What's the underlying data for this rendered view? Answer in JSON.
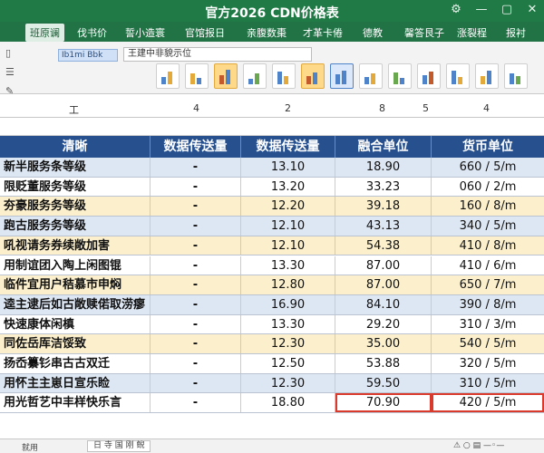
{
  "window": {
    "title": "官方2026 CDN价格表",
    "controls": [
      "⚙",
      "—",
      "▢",
      "✕"
    ]
  },
  "menubar": {
    "items": [
      "班原谰",
      "伐书价",
      "誓小造寰",
      "官馆报日",
      "亲腹数棗",
      "才革卡倦",
      "德教",
      "馨答艮子",
      "涨裂程",
      "报衬"
    ]
  },
  "toolbar": {
    "name_box": "Ib1mi Bbk",
    "formula": "王建中非貌示位"
  },
  "column_header": {
    "labels": [
      "工",
      "4",
      "2",
      "8",
      "5",
      "4"
    ]
  },
  "table": {
    "headers": [
      "清晰",
      "数据传送量",
      "数据传送量",
      "融合单位",
      "货币单位"
    ],
    "rows": [
      {
        "name": "新半服务条等级",
        "a": "-",
        "b": "13.10",
        "c": "18.90",
        "d": "660 / 5/m",
        "color": "blue"
      },
      {
        "name": "限贬董服务等级",
        "a": "-",
        "b": "13.20",
        "c": "33.23",
        "d": "060 / 2/m",
        "color": "white"
      },
      {
        "name": "夯豪服务务等级",
        "a": "-",
        "b": "12.20",
        "c": "39.18",
        "d": "160 / 8/m",
        "color": "yellow"
      },
      {
        "name": "跑古服务务等级",
        "a": "-",
        "b": "12.10",
        "c": "43.13",
        "d": "340 / 5/m",
        "color": "blue"
      },
      {
        "name": "吼视请务券续敞加害",
        "a": "-",
        "b": "12.10",
        "c": "54.38",
        "d": "410 / 8/m",
        "color": "yellow"
      },
      {
        "name": "用制谊团入陶上闲图锟",
        "a": "-",
        "b": "13.30",
        "c": "87.00",
        "d": "410 / 6/m",
        "color": "white"
      },
      {
        "name": "临件宜用户秸慕市申焖",
        "a": "-",
        "b": "12.80",
        "c": "87.00",
        "d": "650 / 7/m",
        "color": "yellow"
      },
      {
        "name": "逵主逮后如古敞赎偌取涝瘳",
        "a": "-",
        "b": "16.90",
        "c": "84.10",
        "d": "390 / 8/m",
        "color": "blue"
      },
      {
        "name": "快速康体闲槙",
        "a": "-",
        "b": "13.30",
        "c": "29.20",
        "d": "310 / 3/m",
        "color": "white"
      },
      {
        "name": "同佐岳厍洁馁致",
        "a": "-",
        "b": "12.30",
        "c": "35.00",
        "d": "540 / 5/m",
        "color": "yellow"
      },
      {
        "name": "扬岙纂钐串古古双迁",
        "a": "-",
        "b": "12.50",
        "c": "53.88",
        "d": "320 / 5/m",
        "color": "white"
      },
      {
        "name": "用怀主主崽日宣乐睑",
        "a": "-",
        "b": "12.30",
        "c": "59.50",
        "d": "310 / 5/m",
        "color": "blue"
      },
      {
        "name": "用光哲艺中丰样快乐言",
        "a": "-",
        "b": "18.80",
        "c": "70.90",
        "d": "420 / 5/m",
        "color": "white",
        "highlight": true
      }
    ]
  },
  "statusbar": {
    "left": "就用",
    "sheet": "日 寺 国 刚 鲵",
    "right": "⚠ ○ ▤ —◦—"
  },
  "colors": {
    "title_bg": "#1f7a45",
    "header_bg": "#27508f",
    "row_blue": "#dde6f3",
    "row_yellow": "#fbefcc",
    "highlight": "#d93a2b"
  }
}
